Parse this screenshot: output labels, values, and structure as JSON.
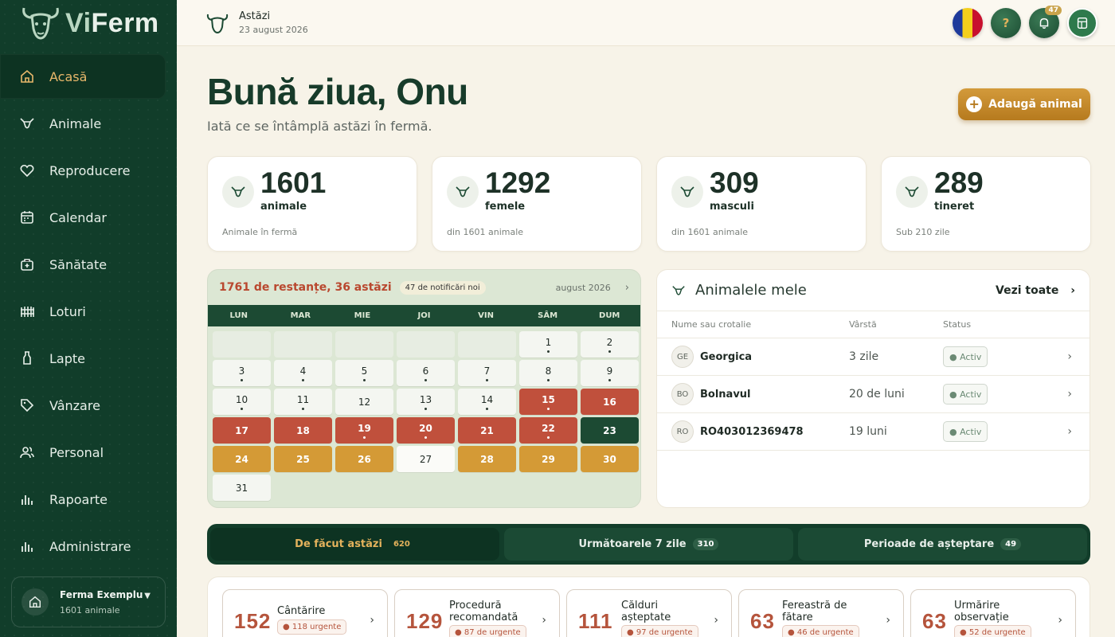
{
  "app": {
    "name_part1": "Vi",
    "name_part2": "Ferm"
  },
  "sidebar": {
    "items": [
      {
        "label": "Acasă",
        "icon": "home-icon",
        "active": true
      },
      {
        "label": "Animale",
        "icon": "cow-icon"
      },
      {
        "label": "Reproducere",
        "icon": "heart-icon"
      },
      {
        "label": "Calendar",
        "icon": "calendar-icon"
      },
      {
        "label": "Sănătate",
        "icon": "medical-kit-icon"
      },
      {
        "label": "Loturi",
        "icon": "fence-icon"
      },
      {
        "label": "Lapte",
        "icon": "milk-bottle-icon"
      },
      {
        "label": "Vânzare",
        "icon": "tag-icon"
      },
      {
        "label": "Personal",
        "icon": "people-icon"
      },
      {
        "label": "Rapoarte",
        "icon": "bar-chart-icon"
      },
      {
        "label": "Administrare",
        "icon": "bar-chart-icon"
      }
    ],
    "farm": {
      "name": "Ferma Exemplu",
      "count": "1601 animale"
    }
  },
  "topbar": {
    "title": "Astăzi",
    "date": "23 august 2026",
    "notifications": "47"
  },
  "hero": {
    "title": "Bună ziua, Onu",
    "subtitle": "Iată ce se întâmplă astăzi în fermă.",
    "add_button": "Adaugă animal"
  },
  "stats": [
    {
      "value": "1601",
      "label": "animale",
      "sub": "Animale în fermă"
    },
    {
      "value": "1292",
      "label": "femele",
      "sub": "din 1601 animale"
    },
    {
      "value": "309",
      "label": "masculi",
      "sub": "din 1601 animale"
    },
    {
      "value": "289",
      "label": "tineret",
      "sub": "Sub 210 zile"
    }
  ],
  "calendar": {
    "due": "1761 de restanțe, 36 astăzi",
    "notifications": "47 de notificări noi",
    "month": "august 2026",
    "weekdays": [
      "LUN",
      "MAR",
      "MIE",
      "JOI",
      "VIN",
      "SÂM",
      "DUM"
    ],
    "days": [
      {
        "d": ""
      },
      {
        "d": ""
      },
      {
        "d": ""
      },
      {
        "d": ""
      },
      {
        "d": ""
      },
      {
        "d": "1",
        "dot": true
      },
      {
        "d": "2",
        "dot": true
      },
      {
        "d": "3",
        "dot": true
      },
      {
        "d": "4",
        "dot": true
      },
      {
        "d": "5",
        "dot": true
      },
      {
        "d": "6",
        "dot": true
      },
      {
        "d": "7",
        "dot": true
      },
      {
        "d": "8",
        "dot": true
      },
      {
        "d": "9",
        "dot": true
      },
      {
        "d": "10",
        "dot": true
      },
      {
        "d": "11",
        "dot": true
      },
      {
        "d": "12"
      },
      {
        "d": "13",
        "dot": true
      },
      {
        "d": "14",
        "dot": true
      },
      {
        "d": "15",
        "s": "red",
        "dot": true
      },
      {
        "d": "16",
        "s": "red"
      },
      {
        "d": "17",
        "s": "red"
      },
      {
        "d": "18",
        "s": "red"
      },
      {
        "d": "19",
        "s": "red",
        "dot": true
      },
      {
        "d": "20",
        "s": "red",
        "dot": true
      },
      {
        "d": "21",
        "s": "red"
      },
      {
        "d": "22",
        "s": "red",
        "dot": true
      },
      {
        "d": "23",
        "s": "today"
      },
      {
        "d": "24",
        "s": "orange"
      },
      {
        "d": "25",
        "s": "orange"
      },
      {
        "d": "26",
        "s": "orange"
      },
      {
        "d": "27",
        "s": "dim"
      },
      {
        "d": "28",
        "s": "orange"
      },
      {
        "d": "29",
        "s": "orange"
      },
      {
        "d": "30",
        "s": "orange"
      },
      {
        "d": "31"
      }
    ]
  },
  "animals": {
    "title": "Animalele mele",
    "view_all": "Vezi toate",
    "columns": [
      "Nume sau crotalie",
      "Vârstă",
      "Status"
    ],
    "rows": [
      {
        "initials": "GE",
        "name": "Georgica",
        "age": "3 zile",
        "status": "● Activ"
      },
      {
        "initials": "BO",
        "name": "Bolnavul",
        "age": "20 de luni",
        "status": "● Activ"
      },
      {
        "initials": "RO",
        "name": "RO403012369478",
        "age": "19 luni",
        "status": "● Activ"
      }
    ]
  },
  "tabs": [
    {
      "label": "De făcut astăzi",
      "count": "620",
      "active": true
    },
    {
      "label": "Următoarele 7 zile",
      "count": "310"
    },
    {
      "label": "Perioade de așteptare",
      "count": "49"
    }
  ],
  "tasks": [
    {
      "num": "152",
      "label": "Cântărire",
      "urgent": "● 118 urgente"
    },
    {
      "num": "129",
      "label": "Procedură recomandată",
      "urgent": "● 87 de urgente"
    },
    {
      "num": "111",
      "label": "Călduri așteptate",
      "urgent": "● 97 de urgente"
    },
    {
      "num": "63",
      "label": "Fereastră de fătare",
      "urgent": "● 46 de urgente"
    },
    {
      "num": "63",
      "label": "Urmărire observație",
      "urgent": "● 52 de urgente"
    }
  ],
  "colors": {
    "brand_green": "#113d2a",
    "accent_gold": "#d49a36",
    "alert_red": "#c0503c"
  }
}
